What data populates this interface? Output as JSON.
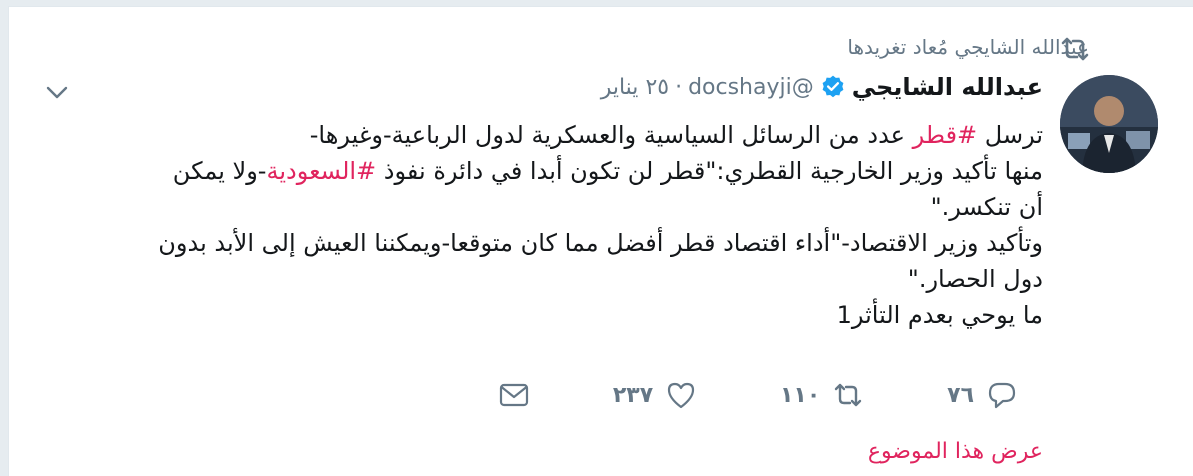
{
  "retweet_context": {
    "text": "عبدالله الشايجي مُعاد تغريدها"
  },
  "author": {
    "display_name": "عبدالله الشايجي",
    "handle": "@docshayji",
    "separator": "·",
    "date": "٢٥ يناير",
    "verified": true
  },
  "tweet": {
    "lines": [
      [
        {
          "text": "ترسل ",
          "hashtag": false
        },
        {
          "text": "#قطر",
          "hashtag": true
        },
        {
          "text": " عدد من الرسائل السياسية والعسكرية لدول الرباعية-وغيرها-",
          "hashtag": false
        }
      ],
      [
        {
          "text": "منها تأكيد وزير الخارجية القطري:\"قطر لن تكون أبدا في دائرة نفوذ ",
          "hashtag": false
        },
        {
          "text": "#السعودية",
          "hashtag": true
        },
        {
          "text": "-ولا يمكن",
          "hashtag": false
        }
      ],
      [
        {
          "text": "أن تنكسر.\"",
          "hashtag": false
        }
      ],
      [
        {
          "text": "وتأكيد وزير الاقتصاد-\"أداء اقتصاد قطر أفضل مما كان متوقعا-ويمكننا العيش إلى الأبد بدون",
          "hashtag": false
        }
      ],
      [
        {
          "text": "دول الحصار.\"",
          "hashtag": false
        }
      ],
      [
        {
          "text": "ما يوحي بعدم التأثر1",
          "hashtag": false
        }
      ]
    ]
  },
  "actions": {
    "reply_count": "٧٦",
    "retweet_count": "١١٠",
    "like_count": "٢٣٧"
  },
  "show_thread": "عرض هذا الموضوع",
  "colors": {
    "accent": "#e0245e",
    "verified": "#1da1f2",
    "muted": "#657786",
    "text": "#14171a"
  },
  "icons": {
    "retweet_context": "retweet-icon",
    "verified": "verified-badge-icon",
    "caret": "chevron-down-icon",
    "reply": "reply-icon",
    "retweet": "retweet-icon",
    "like": "heart-icon",
    "dm": "envelope-icon"
  }
}
